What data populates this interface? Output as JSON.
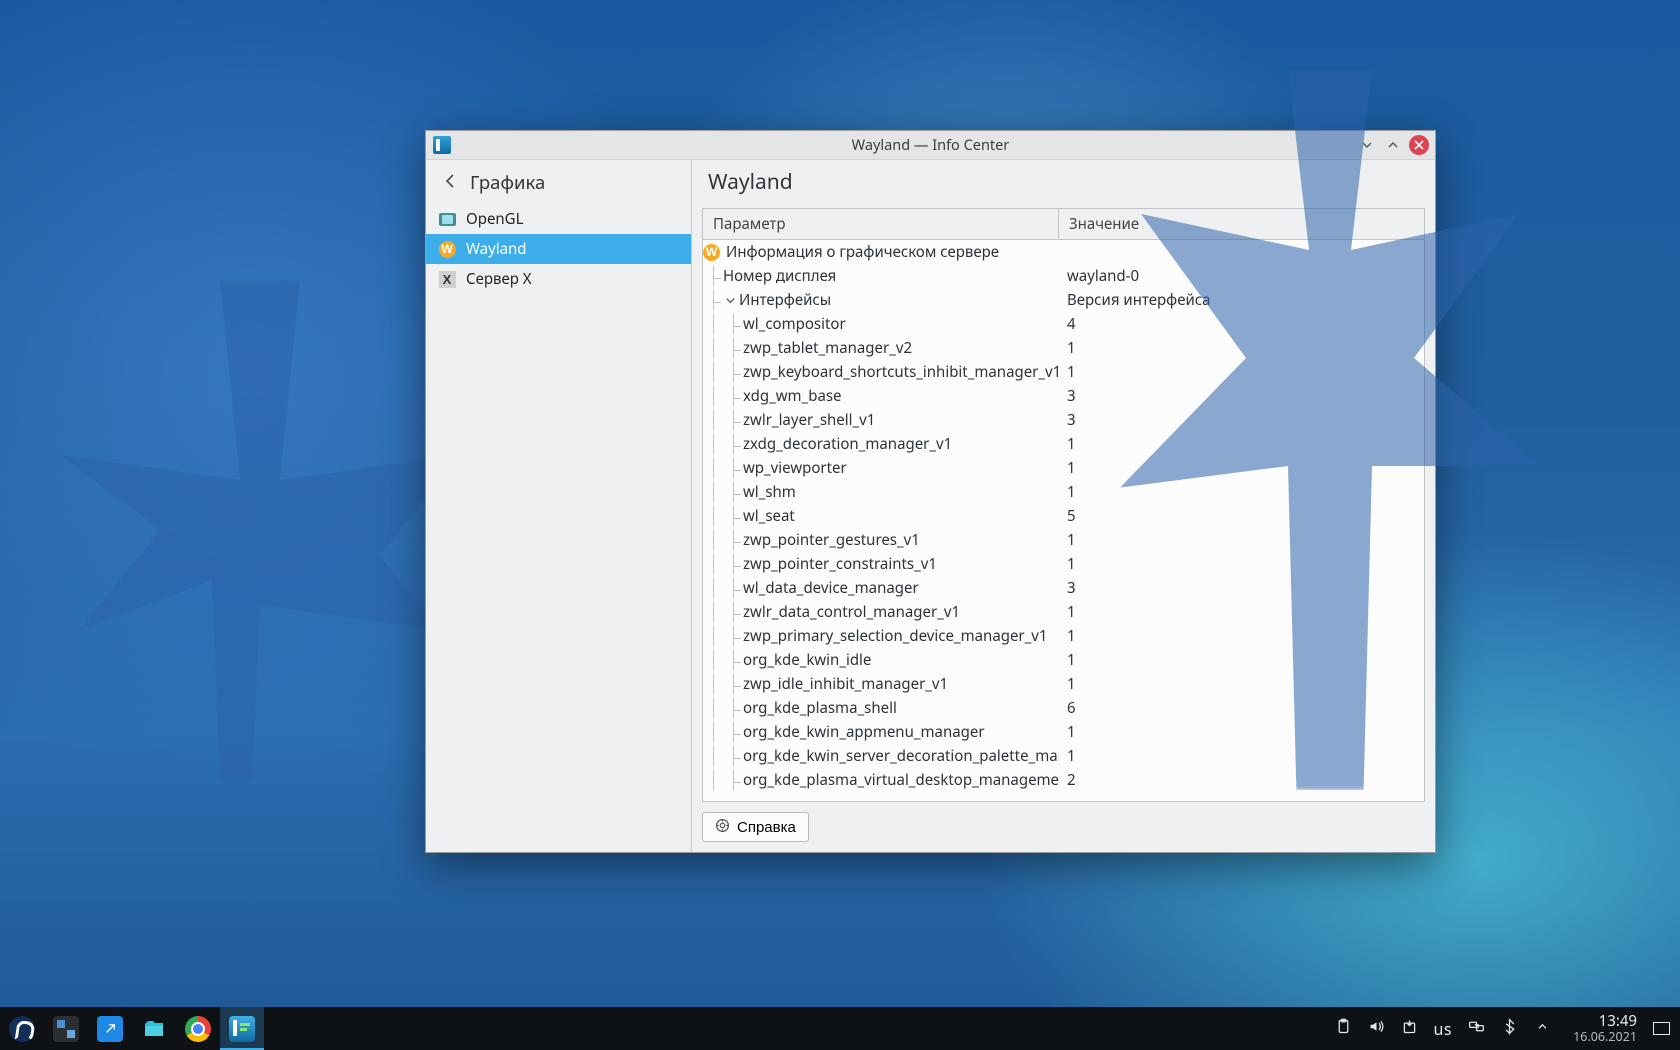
{
  "window": {
    "title": "Wayland — Info Center",
    "breadcrumb_back_label": "Графика",
    "page_title": "Wayland",
    "help_button": "Справка"
  },
  "sidebar": {
    "items": [
      {
        "label": "OpenGL",
        "icon": "opengl-icon",
        "active": false
      },
      {
        "label": "Wayland",
        "icon": "wayland-icon",
        "active": true
      },
      {
        "label": "Сервер X",
        "icon": "xserver-icon",
        "active": false
      }
    ]
  },
  "table": {
    "columns": {
      "param": "Параметр",
      "value": "Значение"
    },
    "root": {
      "label": "Информация о графическом сервере"
    },
    "display": {
      "label": "Номер дисплея",
      "value": "wayland-0"
    },
    "ifaces_header": {
      "label": "Интерфейсы",
      "value": "Версия интерфейса"
    },
    "interfaces": [
      {
        "name": "wl_compositor",
        "ver": "4"
      },
      {
        "name": "zwp_tablet_manager_v2",
        "ver": "1"
      },
      {
        "name": "zwp_keyboard_shortcuts_inhibit_manager_v1",
        "ver": "1"
      },
      {
        "name": "xdg_wm_base",
        "ver": "3"
      },
      {
        "name": "zwlr_layer_shell_v1",
        "ver": "3"
      },
      {
        "name": "zxdg_decoration_manager_v1",
        "ver": "1"
      },
      {
        "name": "wp_viewporter",
        "ver": "1"
      },
      {
        "name": "wl_shm",
        "ver": "1"
      },
      {
        "name": "wl_seat",
        "ver": "5"
      },
      {
        "name": "zwp_pointer_gestures_v1",
        "ver": "1"
      },
      {
        "name": "zwp_pointer_constraints_v1",
        "ver": "1"
      },
      {
        "name": "wl_data_device_manager",
        "ver": "3"
      },
      {
        "name": "zwlr_data_control_manager_v1",
        "ver": "1"
      },
      {
        "name": "zwp_primary_selection_device_manager_v1",
        "ver": "1"
      },
      {
        "name": "org_kde_kwin_idle",
        "ver": "1"
      },
      {
        "name": "zwp_idle_inhibit_manager_v1",
        "ver": "1"
      },
      {
        "name": "org_kde_plasma_shell",
        "ver": "6"
      },
      {
        "name": "org_kde_kwin_appmenu_manager",
        "ver": "1"
      },
      {
        "name": "org_kde_kwin_server_decoration_palette_manager",
        "ver": "1"
      },
      {
        "name": "org_kde_plasma_virtual_desktop_management",
        "ver": "2"
      }
    ]
  },
  "taskbar": {
    "kb_layout": "us",
    "time": "13:49",
    "date": "16.06.2021"
  }
}
